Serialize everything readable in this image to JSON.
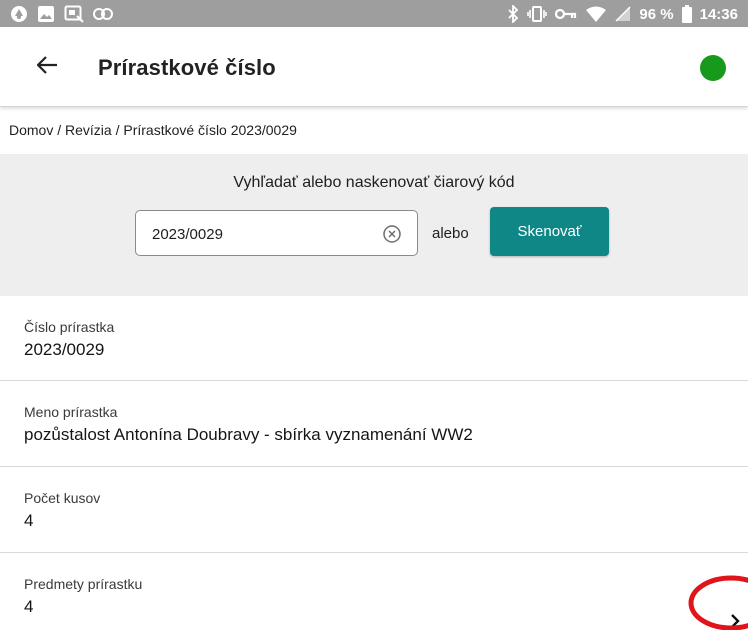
{
  "status_bar": {
    "battery_percent": "96 %",
    "time": "14:36",
    "icons": [
      "app-icon",
      "image-icon",
      "screenshot-icon",
      "link-icon",
      "bluetooth-icon",
      "vibrate-icon",
      "vpn-key-icon",
      "wifi-icon",
      "no-signal-icon",
      "battery-icon"
    ]
  },
  "app_bar": {
    "title": "Prírastkové číslo",
    "status_color": "#179a1c"
  },
  "breadcrumb": "Domov / Revízia / Prírastkové číslo 2023/0029",
  "search": {
    "label": "Vyhľadať alebo naskenovať čiarový kód",
    "value": "2023/0029",
    "or_label": "alebo",
    "scan_label": "Skenovať"
  },
  "fields": [
    {
      "label": "Číslo prírastka",
      "value": "2023/0029"
    },
    {
      "label": "Meno prírastka",
      "value": "pozůstalost Antonína Doubravy - sbírka vyznamenání WW2"
    },
    {
      "label": "Počet kusov",
      "value": "4"
    },
    {
      "label": "Predmety prírastku",
      "value": "4"
    }
  ],
  "colors": {
    "accent": "#0e8786",
    "status_bar": "#9e9e9e",
    "highlight": "#e0141b"
  }
}
